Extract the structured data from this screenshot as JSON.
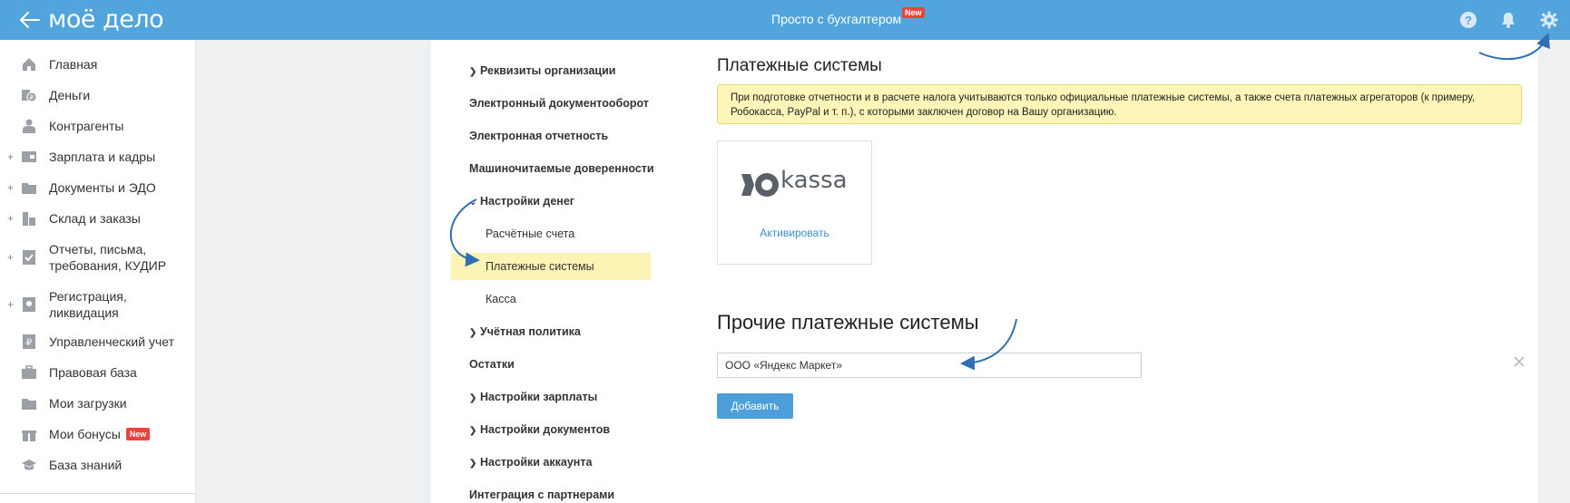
{
  "header": {
    "logo_text": "моё дело",
    "title": "Просто с бухгалтером",
    "new_badge": "New",
    "brand_color": "#51a4dc",
    "icons": [
      "back-arrow-icon",
      "help-icon",
      "bell-icon",
      "gear-icon"
    ]
  },
  "sidebar": {
    "items": [
      {
        "label": "Главная",
        "icon": "home-icon"
      },
      {
        "label": "Деньги",
        "icon": "money-icon"
      },
      {
        "label": "Контрагенты",
        "icon": "contractors-icon"
      },
      {
        "label": "Зарплата и кадры",
        "icon": "salary-icon",
        "expandable": true
      },
      {
        "label": "Документы и ЭДО",
        "icon": "folder-icon",
        "expandable": true
      },
      {
        "label": "Склад и заказы",
        "icon": "warehouse-icon",
        "expandable": true
      },
      {
        "label": "Отчеты, письма, требования, КУДИР",
        "icon": "reports-icon",
        "expandable": true
      },
      {
        "label": "Регистрация, ликвидация",
        "icon": "registration-icon",
        "expandable": true
      },
      {
        "label": "Управленческий учет",
        "icon": "management-icon"
      },
      {
        "label": "Правовая база",
        "icon": "briefcase-icon"
      },
      {
        "label": "Мои загрузки",
        "icon": "folder-icon"
      },
      {
        "label": "Мои бонусы",
        "icon": "gift-icon",
        "badge": "New"
      },
      {
        "label": "База знаний",
        "icon": "graduation-cap-icon"
      }
    ]
  },
  "settings_nav": {
    "items": [
      {
        "label": "Реквизиты организации",
        "chevron": "right"
      },
      {
        "label": "Электронный документооборот"
      },
      {
        "label": "Электронная отчетность"
      },
      {
        "label": "Машиночитаемые доверенности"
      },
      {
        "label": "Настройки денег",
        "chevron": "down"
      },
      {
        "label": "Расчётные счета",
        "sub": true
      },
      {
        "label": "Платежные системы",
        "sub": true,
        "active": true
      },
      {
        "label": "Касса",
        "sub": true
      },
      {
        "label": "Учётная политика",
        "chevron": "right"
      },
      {
        "label": "Остатки"
      },
      {
        "label": "Настройки зарплаты",
        "chevron": "right"
      },
      {
        "label": "Настройки документов",
        "chevron": "right"
      },
      {
        "label": "Настройки аккаунта",
        "chevron": "right"
      },
      {
        "label": "Интеграция с партнерами"
      }
    ]
  },
  "main": {
    "title": "Платежные системы",
    "notice": "При подготовке отчетности и в расчете налога учитываются только официальные платежные системы, а также счета платежных агрегаторов (к примеру, Робокасса, PayPal и т. п.), с которыми заключен договор на Вашу организацию.",
    "kassa": {
      "logo_text": "kassa",
      "activate_label": "Активировать"
    },
    "other_title": "Прочие платежные системы",
    "other_input_value": "ООО «Яндекс Маркет»",
    "add_label": "Добавить"
  }
}
